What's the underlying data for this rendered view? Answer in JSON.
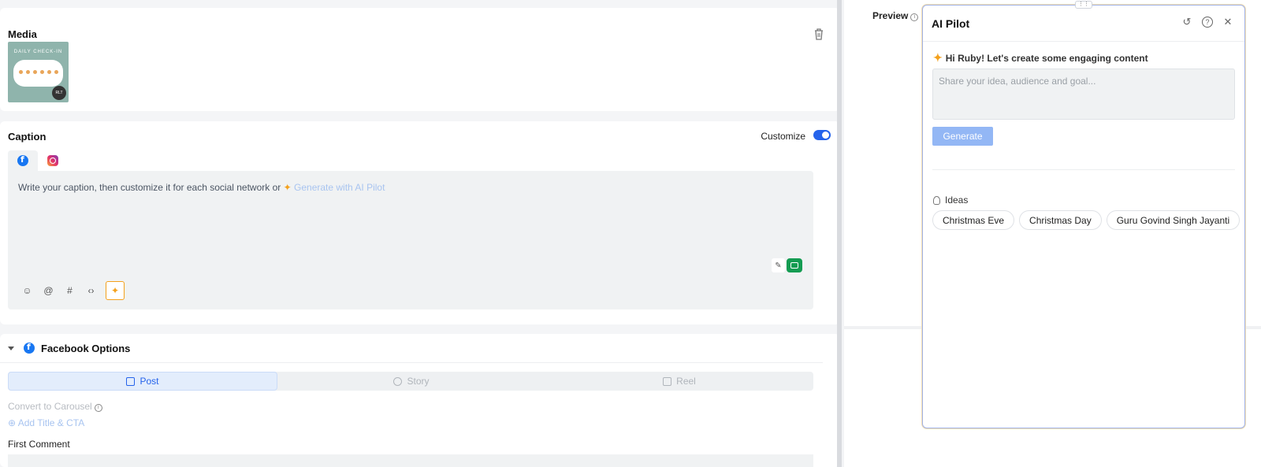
{
  "media": {
    "title": "Media",
    "thumb_title": "DAILY CHECK-IN",
    "thumb_badge": "RLT"
  },
  "caption": {
    "title": "Caption",
    "customize_label": "Customize",
    "placeholder": "Write your caption, then customize it for each social network or",
    "ai_link": "Generate with AI Pilot"
  },
  "facebook_options": {
    "title": "Facebook Options",
    "tabs": [
      {
        "label": "Post",
        "active": true
      },
      {
        "label": "Story",
        "active": false
      },
      {
        "label": "Reel",
        "active": false
      }
    ],
    "convert_label": "Convert to Carousel",
    "add_title_cta": "Add Title & CTA",
    "first_comment": "First Comment"
  },
  "preview": {
    "label": "Preview"
  },
  "ai_pilot": {
    "title": "AI Pilot",
    "greeting": "Hi Ruby! Let's create some engaging content",
    "input_placeholder": "Share your idea, audience and goal...",
    "generate_label": "Generate",
    "ideas_label": "Ideas",
    "ideas": [
      "Christmas Eve",
      "Christmas Day",
      "Guru Govind Singh Jayanti"
    ]
  },
  "colors": {
    "accent": "#2563eb",
    "facebook": "#1877f2",
    "ai_spark": "#f4a11c",
    "grammarly": "#149c52"
  }
}
